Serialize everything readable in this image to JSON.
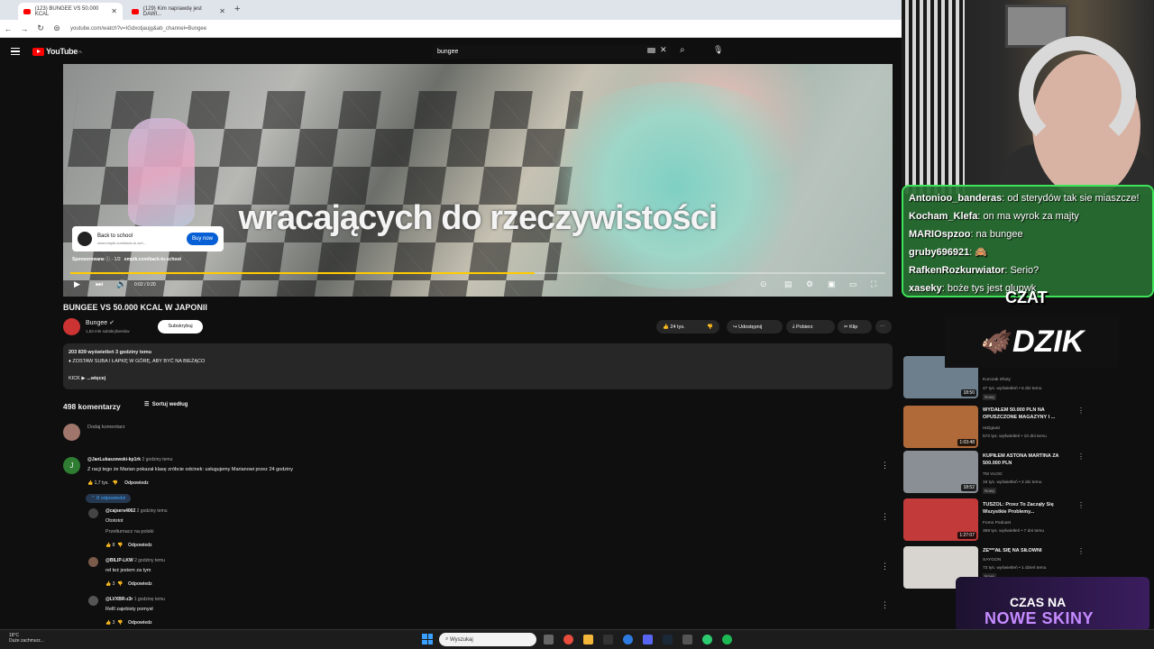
{
  "browser": {
    "tabs": [
      {
        "title": "(123) BUNGEE VS 50.000 KCAL"
      },
      {
        "title": "(129) Kim naprawdę jest DAWI..."
      }
    ],
    "new_tab": "+",
    "url": "youtube.com/watch?v=IGdxotjaujg&ab_channel=Bungee"
  },
  "youtube": {
    "logo": "YouTube",
    "region": "PL",
    "search_value": "bungee"
  },
  "video": {
    "caption": "wracających do rzeczywistości",
    "progress": 0.57,
    "time": "0:02 / 0:20",
    "ad": {
      "title": "Back to school",
      "url": "www.empik.com/back-to-sch...",
      "button": "Buy now",
      "sponsor_label": "Sponsorowane",
      "sponsor_count": "· 1/2",
      "sponsor_link": "empik.com/back-to-school"
    },
    "title": "BUNGEE VS 50.000 KCAL W JAPONII",
    "channel": "Bungee",
    "subscribers": "1,53 mln subskrybentów",
    "subscribe": "Subskrybuj",
    "likes": "24 tys.",
    "share": "Udostępnij",
    "download": "Pobierz",
    "clip": "Klip"
  },
  "description": {
    "stats": "203 839 wyświetleń  3 godziny temu",
    "line1": "♦ ZOSTAW SUBA I ŁAPKĘ W GÓRĘ, ABY BYĆ NA BIEŻĄCO",
    "line2": "KICK ▶",
    "more": "...więcej"
  },
  "comments": {
    "count": "498 komentarzy",
    "sort": "Sortuj według",
    "add": "Dodaj komentarz",
    "top": {
      "avatar_letter": "J",
      "user": "@JanLukaszewski-kp1rk",
      "time": "2 godziny temu",
      "text": "Z racji tego że Marian pokazał klasę zróbcie odcinek: usługujemy Marianowi przez 24 godziny",
      "likes": "1,7 tys.",
      "reply": "Odpowiedz",
      "replies_label": "8 odpowiedzi"
    },
    "replies": [
      {
        "user": "@cajsers4062",
        "time": "2 godziny temu",
        "text": "Otototot",
        "translate": "Przetłumacz na polski",
        "likes": "8",
        "reply": "Odpowiedz"
      },
      {
        "user": "@BILIP-LKW",
        "time": "2 godziny temu",
        "text": "rel też jestem za tym",
        "translate": "",
        "likes": "3",
        "reply": "Odpowiedz"
      },
      {
        "user": "@LVXBR-z3r",
        "time": "1 godzinę temu",
        "text": "Relll zajebisty pomysł",
        "translate": "",
        "likes": "3",
        "reply": "Odpowiedz"
      }
    ]
  },
  "stream": {
    "chat": [
      {
        "name": "Antonioo_banderas",
        "msg": ": od sterydów tak sie miaszcze!"
      },
      {
        "name": "Kocham_Klefa",
        "msg": ": on ma wyrok za majty"
      },
      {
        "name": "MARIOspzoo",
        "msg": ": na bungee"
      },
      {
        "name": "gruby696921",
        "msg": ": 🙈"
      },
      {
        "name": "RafkenRozkurwiator",
        "msg": ": Serio?"
      },
      {
        "name": "xasekу",
        "msg": ": boże tys jest glupwk"
      }
    ],
    "chat_label": "CZAT",
    "sponsor": "DZIK",
    "promo_line1": "CZAS NA",
    "promo_line2": "NOWE SKINY"
  },
  "sidebar": [
    {
      "title": "",
      "channel": "Kurczak Shoty",
      "meta": "47 tys. wyświetleń • 5 dni temu",
      "badge": "Nowy",
      "duration": "18:50",
      "color": "#6d7f8d"
    },
    {
      "title": "WYDAŁEM 50.000 PLN NA OPUSZCZONE MAGAZYNY I ...",
      "channel": "reZigiusz",
      "meta": "572 tys. wyświetleń • 10 dni temu",
      "badge": "",
      "duration": "1:03:48",
      "color": "#b06a3a"
    },
    {
      "title": "KUPIŁEM ASTONA MARTINA ZA 500.000 PLN",
      "channel": "TM VLOG",
      "meta": "16 tys. wyświetleń • 2 dni temu",
      "badge": "Nowy",
      "duration": "18:52",
      "color": "#8a8f95"
    },
    {
      "title": "TUSZOL: Przez To Zacząły Się Wszystkie Problemy...",
      "channel": "Fomo Podcast",
      "meta": "359 tys. wyświetleń • 7 dni temu",
      "badge": "",
      "duration": "1:27:07",
      "color": "#c23a3a"
    },
    {
      "title": "ZE***AŁ SIĘ NA SIŁOWNI",
      "channel": "SAYGON",
      "meta": "73 tys. wyświetleń • 1 dzień temu",
      "badge": "Nowy",
      "duration": "",
      "color": "#d8d4cf"
    }
  ],
  "taskbar": {
    "temp": "18°C",
    "weather": "Duże zachmurz...",
    "search": "Wyszukaj"
  }
}
